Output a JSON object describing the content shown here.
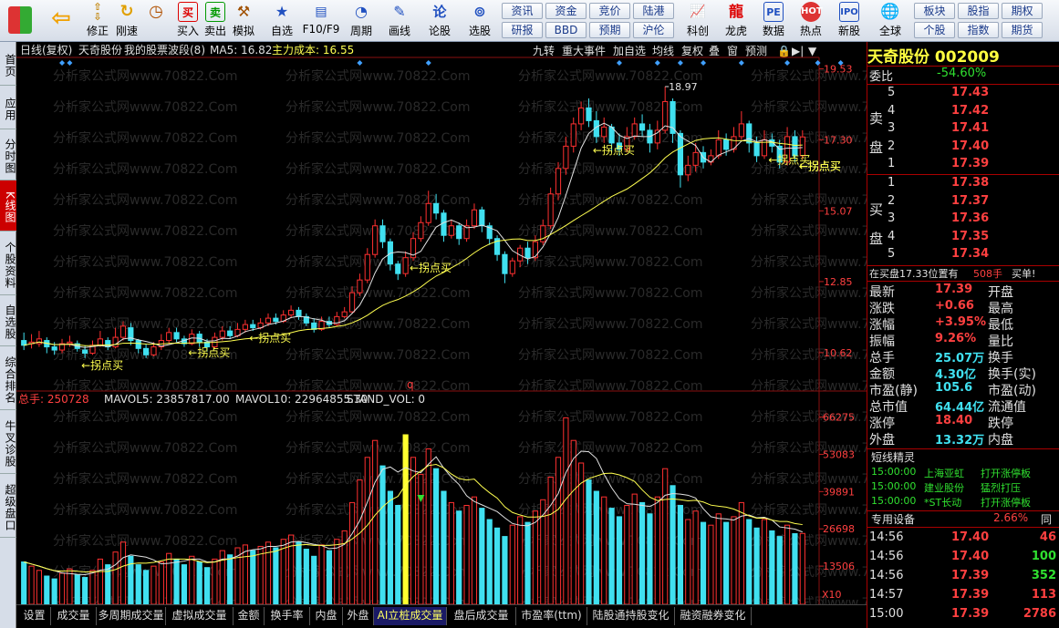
{
  "toolbar": {
    "btns": [
      "修正",
      "刚速",
      "买入",
      "卖出",
      "模拟",
      "自选",
      "F10/F9",
      "周期",
      "画线",
      "论股",
      "选股",
      "科创",
      "龙虎",
      "数据",
      "热点",
      "新股",
      "全球"
    ],
    "quick": [
      "资讯",
      "资金",
      "竞价",
      "陆港",
      "研报",
      "BBD",
      "预期",
      "沪伦",
      "板块",
      "期权",
      "个股",
      "期货",
      "指数",
      "期权"
    ]
  },
  "lefttabs": [
    "首页",
    "应用",
    "分时图",
    "K线图",
    "个股资料",
    "自选股",
    "综合排名",
    "牛叉诊股",
    "超级盘口"
  ],
  "chart": {
    "header": {
      "period": "日线(复权)",
      "name": "天奇股份",
      "strategy": "我的股票波段(8)",
      "ma5": "MA5: 16.82",
      "cost": "主力成本: 16.55"
    },
    "topbtns": [
      "九转",
      "重大事件",
      "加自选",
      "均线",
      "复权",
      "叠",
      "窗",
      "预测"
    ],
    "price_ticks": [
      "19.53",
      "17.30",
      "15.07",
      "12.85",
      "10.62"
    ],
    "high_label": "18.97",
    "signal_label": "拐点买",
    "q_label": "q",
    "vol_header": {
      "total": "总手: 250728",
      "mavol5": "MAVOL5: 23857817.00",
      "mavol10": "MAVOL10: 22964855.30",
      "stand": "STAND_VOL: 0"
    },
    "vol_ticks": [
      "66275",
      "53083",
      "39891",
      "26698",
      "13506"
    ],
    "vol_unit": "X10",
    "watermark": "分析家公式网www.70822.Com",
    "colors": {
      "up": "#ff3030",
      "down": "#40e0f0",
      "ma5": "#e0e0e0",
      "ma20": "#ffff50",
      "signal": "#ffff50"
    }
  },
  "chart_data": {
    "type": "candlestick",
    "title": "天奇股份 002009 日线(复权)",
    "y_range": [
      9.5,
      19.8
    ],
    "vol_range": [
      0,
      70000
    ],
    "highlight_vol_index": 50,
    "candles": [
      [
        11.0,
        10.85,
        11.25,
        10.7
      ],
      [
        10.9,
        10.95,
        11.2,
        10.75
      ],
      [
        10.9,
        11.05,
        11.3,
        10.8
      ],
      [
        11.0,
        10.8,
        11.1,
        10.6
      ],
      [
        10.8,
        10.7,
        10.95,
        10.55
      ],
      [
        10.7,
        10.9,
        11.05,
        10.6
      ],
      [
        10.9,
        10.95,
        11.15,
        10.8
      ],
      [
        10.9,
        10.75,
        11.0,
        10.65
      ],
      [
        10.7,
        10.6,
        10.85,
        10.45
      ],
      [
        10.6,
        10.85,
        11.0,
        10.55
      ],
      [
        10.85,
        11.05,
        11.3,
        10.8
      ],
      [
        11.0,
        10.8,
        11.1,
        10.7
      ],
      [
        10.8,
        11.1,
        11.4,
        10.75
      ],
      [
        11.1,
        11.45,
        11.6,
        11.0
      ],
      [
        11.4,
        11.0,
        11.55,
        10.85
      ],
      [
        11.0,
        10.75,
        11.05,
        10.6
      ],
      [
        10.75,
        10.55,
        10.9,
        10.45
      ],
      [
        10.55,
        10.8,
        10.95,
        10.5
      ],
      [
        10.8,
        11.0,
        11.2,
        10.7
      ],
      [
        11.0,
        11.25,
        11.4,
        10.9
      ],
      [
        11.25,
        11.05,
        11.4,
        10.95
      ],
      [
        11.05,
        10.9,
        11.15,
        10.8
      ],
      [
        10.9,
        11.2,
        11.35,
        10.85
      ],
      [
        11.2,
        10.95,
        11.3,
        10.8
      ],
      [
        10.95,
        10.8,
        11.05,
        10.65
      ],
      [
        10.8,
        11.1,
        11.25,
        10.75
      ],
      [
        11.1,
        11.3,
        11.45,
        11.0
      ],
      [
        11.3,
        11.15,
        11.45,
        11.05
      ],
      [
        11.15,
        11.35,
        11.55,
        11.1
      ],
      [
        11.35,
        11.5,
        11.65,
        11.25
      ],
      [
        11.5,
        11.4,
        11.65,
        11.3
      ],
      [
        11.4,
        11.55,
        11.7,
        11.35
      ],
      [
        11.55,
        11.7,
        11.85,
        11.45
      ],
      [
        11.7,
        11.6,
        11.85,
        11.5
      ],
      [
        11.6,
        11.8,
        11.95,
        11.55
      ],
      [
        11.8,
        11.95,
        12.1,
        11.7
      ],
      [
        11.95,
        11.75,
        12.05,
        11.65
      ],
      [
        11.75,
        11.55,
        11.85,
        11.45
      ],
      [
        11.55,
        11.35,
        11.7,
        11.25
      ],
      [
        11.35,
        11.6,
        11.75,
        11.3
      ],
      [
        11.6,
        11.5,
        11.75,
        11.4
      ],
      [
        11.5,
        11.75,
        11.9,
        11.45
      ],
      [
        11.75,
        11.9,
        12.05,
        11.7
      ],
      [
        11.9,
        12.5,
        12.7,
        11.85
      ],
      [
        12.5,
        12.9,
        13.1,
        12.4
      ],
      [
        12.9,
        13.7,
        13.9,
        12.8
      ],
      [
        13.7,
        14.6,
        14.8,
        13.6
      ],
      [
        14.6,
        14.1,
        14.8,
        13.9
      ],
      [
        14.1,
        13.4,
        14.2,
        13.2
      ],
      [
        13.4,
        13.1,
        13.5,
        12.9
      ],
      [
        13.1,
        13.6,
        13.8,
        13.0
      ],
      [
        13.6,
        14.2,
        14.4,
        13.5
      ],
      [
        14.2,
        14.7,
        14.9,
        14.1
      ],
      [
        14.7,
        15.3,
        15.7,
        14.6
      ],
      [
        15.3,
        15.0,
        15.6,
        14.8
      ],
      [
        15.0,
        14.3,
        15.1,
        14.1
      ],
      [
        14.3,
        14.6,
        14.8,
        14.2
      ],
      [
        14.6,
        14.2,
        14.7,
        14.0
      ],
      [
        14.2,
        14.6,
        14.8,
        14.1
      ],
      [
        14.6,
        15.1,
        15.3,
        14.5
      ],
      [
        15.1,
        14.6,
        15.2,
        14.4
      ],
      [
        14.6,
        14.2,
        14.7,
        14.0
      ],
      [
        14.2,
        13.7,
        14.3,
        13.5
      ],
      [
        13.7,
        13.1,
        13.8,
        12.8
      ],
      [
        13.1,
        13.5,
        13.6,
        13.0
      ],
      [
        13.5,
        13.9,
        14.0,
        13.3
      ],
      [
        13.9,
        13.6,
        14.1,
        13.4
      ],
      [
        13.6,
        14.1,
        14.3,
        13.5
      ],
      [
        14.1,
        14.6,
        14.8,
        14.0
      ],
      [
        14.6,
        15.6,
        15.8,
        14.5
      ],
      [
        15.6,
        16.4,
        16.6,
        15.4
      ],
      [
        16.4,
        17.1,
        17.4,
        16.2
      ],
      [
        17.1,
        17.8,
        18.0,
        16.9
      ],
      [
        17.8,
        18.3,
        18.5,
        17.6
      ],
      [
        18.3,
        17.9,
        18.6,
        17.7
      ],
      [
        17.9,
        17.4,
        18.2,
        17.2
      ],
      [
        17.4,
        17.7,
        18.0,
        17.2
      ],
      [
        17.7,
        17.2,
        17.8,
        16.9
      ],
      [
        17.2,
        17.0,
        17.5,
        16.8
      ],
      [
        17.0,
        17.4,
        17.7,
        16.9
      ],
      [
        17.4,
        17.8,
        18.0,
        17.3
      ],
      [
        17.8,
        17.6,
        18.1,
        17.4
      ],
      [
        17.6,
        17.2,
        17.8,
        16.9
      ],
      [
        17.2,
        17.6,
        17.9,
        17.0
      ],
      [
        17.6,
        18.5,
        18.97,
        17.5
      ],
      [
        18.5,
        17.5,
        18.6,
        17.2
      ],
      [
        17.5,
        16.2,
        17.6,
        15.8
      ],
      [
        16.2,
        16.5,
        16.8,
        16.0
      ],
      [
        16.5,
        16.9,
        17.2,
        16.3
      ],
      [
        16.9,
        16.6,
        17.1,
        16.4
      ],
      [
        16.6,
        16.8,
        17.0,
        16.5
      ],
      [
        16.8,
        17.3,
        17.6,
        16.7
      ],
      [
        17.3,
        17.0,
        17.5,
        16.8
      ],
      [
        17.0,
        17.4,
        17.7,
        16.9
      ],
      [
        17.4,
        17.8,
        18.2,
        17.3
      ],
      [
        17.8,
        17.2,
        17.9,
        16.9
      ],
      [
        17.2,
        16.8,
        17.4,
        16.6
      ],
      [
        16.8,
        17.3,
        17.6,
        16.7
      ],
      [
        17.3,
        17.1,
        17.5,
        16.9
      ],
      [
        17.1,
        16.6,
        17.3,
        16.4
      ],
      [
        16.6,
        17.4,
        17.7,
        16.5
      ],
      [
        17.4,
        16.8,
        17.6,
        16.6
      ],
      [
        16.8,
        17.39,
        17.6,
        16.7
      ]
    ],
    "volume": [
      15000,
      13500,
      12000,
      10000,
      9000,
      11000,
      12500,
      10500,
      9500,
      12000,
      16000,
      14000,
      18500,
      22000,
      17000,
      14000,
      12000,
      13500,
      15000,
      18000,
      16000,
      14000,
      17000,
      15000,
      13000,
      16000,
      19000,
      17500,
      20000,
      21000,
      19000,
      20500,
      22000,
      20000,
      23000,
      24500,
      22000,
      19500,
      17000,
      21000,
      19000,
      23000,
      26000,
      36000,
      44000,
      52000,
      58000,
      49000,
      40000,
      35000,
      60000,
      52000,
      46000,
      55000,
      48000,
      40000,
      36000,
      33000,
      35000,
      38000,
      34000,
      30000,
      27000,
      24000,
      28000,
      31000,
      29000,
      33000,
      37000,
      45000,
      52000,
      66000,
      58000,
      50000,
      44000,
      40000,
      38000,
      34000,
      31000,
      35000,
      39000,
      36000,
      32000,
      38000,
      48000,
      42000,
      35000,
      30000,
      33000,
      29000,
      28000,
      32000,
      29000,
      31000,
      36000,
      30000,
      27000,
      30000,
      26000,
      24000,
      28000,
      25000,
      25073
    ],
    "signals": [
      8,
      22,
      30,
      51,
      75,
      98,
      105,
      110,
      116
    ]
  },
  "quote": {
    "title": "天奇股份 002009",
    "weibi_label": "委比",
    "weibi": "-54.60%",
    "sell_label": "卖盘",
    "buy_label": "买盘",
    "sells": [
      {
        "lvl": "5",
        "p": "17.43"
      },
      {
        "lvl": "4",
        "p": "17.42"
      },
      {
        "lvl": "3",
        "p": "17.41"
      },
      {
        "lvl": "2",
        "p": "17.40"
      },
      {
        "lvl": "1",
        "p": "17.39"
      }
    ],
    "buys": [
      {
        "lvl": "1",
        "p": "17.38"
      },
      {
        "lvl": "2",
        "p": "17.37"
      },
      {
        "lvl": "3",
        "p": "17.36"
      },
      {
        "lvl": "4",
        "p": "17.35"
      },
      {
        "lvl": "5",
        "p": "17.34"
      }
    ],
    "notice": "在买盘17.33位置有",
    "notice_vol": "508手",
    "notice_end": "买单!",
    "stats": [
      [
        "最新",
        "17.39",
        "开盘"
      ],
      [
        "涨跌",
        "+0.66",
        "最高"
      ],
      [
        "涨幅",
        "+3.95%",
        "最低"
      ],
      [
        "振幅",
        "9.26%",
        "量比"
      ],
      [
        "总手",
        "25.07万",
        "换手"
      ],
      [
        "金额",
        "4.30亿",
        "换手(实)"
      ],
      [
        "市盈(静)",
        "105.6",
        "市盈(动)"
      ],
      [
        "总市值",
        "64.44亿",
        "流通值"
      ],
      [
        "涨停",
        "18.40",
        "跌停"
      ],
      [
        "外盘",
        "13.32万",
        "内盘"
      ]
    ],
    "sprite_title": "短线精灵",
    "sprites": [
      [
        "15:00:00",
        "上海亚虹",
        "打开涨停板"
      ],
      [
        "15:00:00",
        "建业股份",
        "猛烈打压"
      ],
      [
        "15:00:00",
        "*ST长动",
        "打开涨停板"
      ]
    ],
    "device": "专用设备",
    "device_pct": "2.66%",
    "device_end": "同",
    "ticks": [
      [
        "14:56",
        "17.40",
        "46"
      ],
      [
        "14:56",
        "17.40",
        "100"
      ],
      [
        "14:56",
        "17.39",
        "352"
      ],
      [
        "14:57",
        "17.39",
        "113"
      ],
      [
        "15:00",
        "17.39",
        "2786"
      ]
    ]
  },
  "bottomtabs": [
    "设置",
    "成交量",
    "多周期成交量",
    "虚拟成交量",
    "金额",
    "换手率",
    "内盘",
    "外盘",
    "AI立桩成交量",
    "盘后成交量",
    "市盈率(ttm)",
    "陆股通持股变化",
    "融资融券变化"
  ]
}
